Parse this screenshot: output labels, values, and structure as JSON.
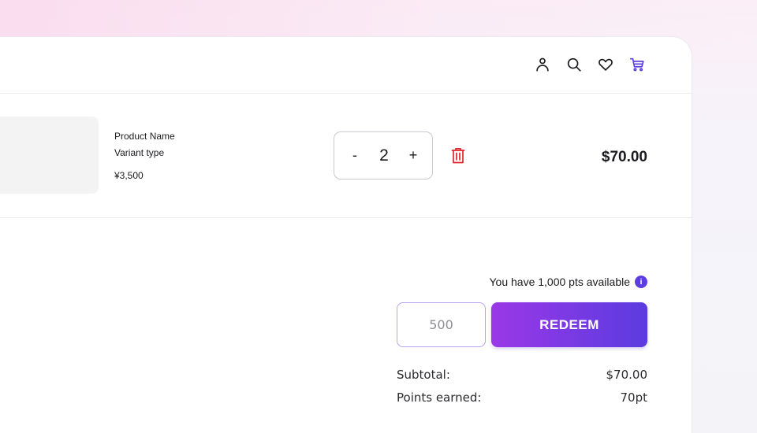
{
  "header": {
    "icons": [
      "user-icon",
      "search-icon",
      "heart-icon",
      "cart-icon"
    ],
    "accent_color": "#5b3de0"
  },
  "cart": {
    "items": [
      {
        "name": "Product Name",
        "variant": "Variant type",
        "unit_price": "¥3,500",
        "quantity": "2",
        "decrement_label": "-",
        "increment_label": "+",
        "line_total": "$70.00"
      }
    ]
  },
  "points": {
    "available_text": "You have 1,000 pts available",
    "info_icon_glyph": "i",
    "input_placeholder": "500",
    "redeem_label": "REDEEM"
  },
  "totals": {
    "subtotal_label": "Subtotal:",
    "subtotal_value": "$70.00",
    "points_label": "Points earned:",
    "points_value": "70pt"
  },
  "colors": {
    "delete": "#e0262b",
    "redeem_gradient_start": "#9a38e6",
    "redeem_gradient_end": "#5b3be0"
  }
}
